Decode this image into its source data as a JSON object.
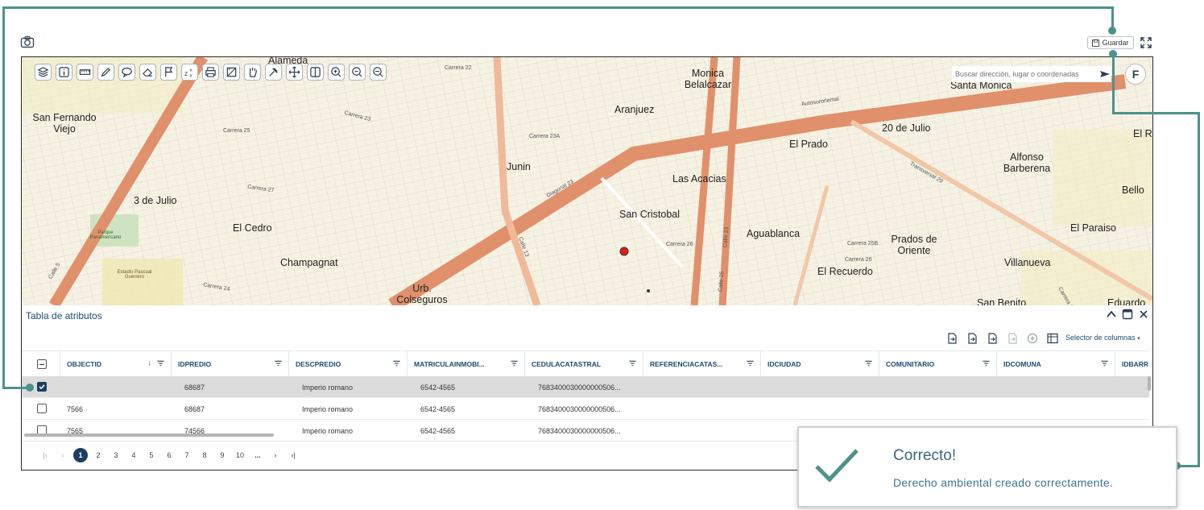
{
  "header": {
    "camera_icon": "camera-icon",
    "save_label": "Guardar",
    "expand_icon": "expand-icon"
  },
  "map": {
    "search_placeholder": "Buscar dirección, lugar o coordenadas",
    "f_button": "F",
    "neighborhoods": [
      "Alameda",
      "Monica Belalcazar",
      "Santa Monica",
      "San Fernando Viejo",
      "Aranjuez",
      "20 de Julio",
      "El Prado",
      "Alfonso Barberena",
      "Junin",
      "Las Acacias",
      "3 de Julio",
      "San Cristobal",
      "Bello",
      "El Cedro",
      "Aguablanca",
      "Prados de Oriente",
      "El Paraiso",
      "Champagnat",
      "El Recuerdo",
      "Villanueva",
      "Urb. Colseguros",
      "San Benito",
      "Eduardo",
      "El R"
    ],
    "streets": [
      "Autosuroriental",
      "Diagonal 23",
      "Transversal 29",
      "Calle 5",
      "Calle 13",
      "Calle 23",
      "Calle 25",
      "Carrera 23",
      "Carrera 23A",
      "Carrera 24",
      "Carrera 25B",
      "Carrera 26",
      "Carrera 27",
      "Carrera 28",
      "Carrera 22",
      "Carrera 25",
      "Carrera 26",
      "Parque Panamericano",
      "Estadio Pascual Guerrero"
    ]
  },
  "toolbar_icons": [
    "layers-icon",
    "info-icon",
    "ruler-icon",
    "pencil-icon",
    "comment-icon",
    "eraser-icon",
    "flag-icon",
    "xyz-icon",
    "print-icon",
    "crop-icon",
    "hand-icon",
    "hammer-icon",
    "move-icon",
    "split-icon",
    "zoom-in-icon",
    "zoom-out-icon",
    "zoom-extent-icon"
  ],
  "table": {
    "title": "Tabla de atributos",
    "column_selector": "Selector de columnas",
    "columns": [
      "OBJECTID",
      "IDPREDIO",
      "DESCPREDIO",
      "MATRICULAINMOBI...",
      "CEDULACATASTRAL",
      "REFERENCIACATAS...",
      "IDCIUDAD",
      "COMUNITARIO",
      "IDCOMUNA",
      "IDBARR"
    ],
    "rows": [
      {
        "selected": true,
        "cells": [
          "",
          "68687",
          "Imperio romano",
          "6542-4565",
          "7683400030000000506...",
          "",
          "",
          "",
          "",
          ""
        ]
      },
      {
        "selected": false,
        "cells": [
          "7566",
          "68687",
          "Imperio romano",
          "6542-4565",
          "7683400030000000506...",
          "",
          "",
          "",
          "",
          ""
        ]
      },
      {
        "selected": false,
        "cells": [
          "7565",
          "74566",
          "Imperio romano",
          "6542-4565",
          "7683400030000000506...",
          "",
          "",
          "",
          "",
          ""
        ]
      }
    ],
    "pages": [
      "1",
      "2",
      "3",
      "4",
      "5",
      "6",
      "7",
      "8",
      "9",
      "10",
      "..."
    ],
    "current_page": "1"
  },
  "toast": {
    "title": "Correcto!",
    "message": "Derecho ambiental creado correctamente.",
    "icon": "check-icon"
  },
  "colors": {
    "accent": "#1c3f62",
    "callout": "#4e918c",
    "road": "#e0906b",
    "toast_text": "#3a6680"
  }
}
